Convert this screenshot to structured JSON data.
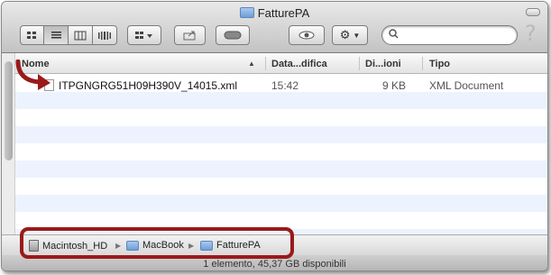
{
  "window": {
    "title": "FatturePA",
    "help_glyph": "?"
  },
  "toolbar": {
    "view_icons": [
      "icon-view-icon",
      "list-view-icon",
      "column-view-icon",
      "coverflow-view-icon"
    ],
    "arrange_icon": "arrange-icon",
    "share_icon": "share-icon",
    "tag_icon": "tag-icon",
    "quicklook_icon": "eye-icon",
    "action_icon": "gear-icon",
    "search": {
      "placeholder": "",
      "value": ""
    }
  },
  "columns": [
    {
      "label": "Nome"
    },
    {
      "label": "Data...difica"
    },
    {
      "label": "Di...ioni"
    },
    {
      "label": "Tipo"
    }
  ],
  "files": [
    {
      "name": "ITPGNGRG51H09H390V_14015.xml",
      "modified": "15:42",
      "size": "9 KB",
      "kind": "XML Document"
    }
  ],
  "pathbar": {
    "items": [
      {
        "label": "Macintosh_HD",
        "icon": "hard-drive-icon"
      },
      {
        "label": "MacBook",
        "icon": "folder-icon"
      },
      {
        "label": "FatturePA",
        "icon": "folder-icon"
      }
    ]
  },
  "status": {
    "text": "1 elemento, 45,37 GB disponibili"
  },
  "colors": {
    "annotation": "#9a1a1a",
    "stripe": "#edf3fe",
    "folder": "#6f9fd6"
  }
}
